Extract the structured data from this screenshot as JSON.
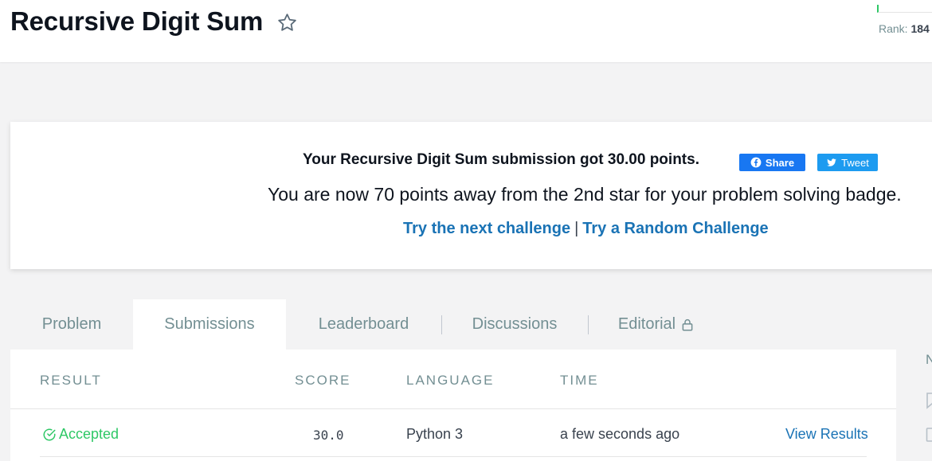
{
  "header": {
    "title": "Recursive Digit Sum",
    "rank_label": "Rank:",
    "rank_value": "184"
  },
  "banner": {
    "message": "Your Recursive Digit Sum submission got 30.00 points.",
    "share_label": "Share",
    "tweet_label": "Tweet",
    "points_message": "You are now 70 points away from the 2nd star for your problem solving badge.",
    "next_challenge": "Try the next challenge",
    "separator": "|",
    "random_challenge": "Try a Random Challenge"
  },
  "tabs": [
    {
      "label": "Problem",
      "active": false
    },
    {
      "label": "Submissions",
      "active": true
    },
    {
      "label": "Leaderboard",
      "active": false
    },
    {
      "label": "Discussions",
      "active": false
    },
    {
      "label": "Editorial",
      "active": false,
      "locked": true
    }
  ],
  "table": {
    "headers": [
      "RESULT",
      "SCORE",
      "LANGUAGE",
      "TIME"
    ],
    "rows": [
      {
        "result": "Accepted",
        "score": "30.0",
        "language": "Python 3",
        "time": "a few seconds ago",
        "action": "View Results"
      }
    ]
  },
  "sidebar": {
    "letter": "N"
  },
  "colors": {
    "accent": "#1a73b5",
    "success": "#2ec866",
    "facebook": "#1877f2",
    "twitter": "#1d9bf0"
  },
  "icons": [
    "star-icon",
    "facebook-icon",
    "twitter-icon",
    "lock-icon",
    "check-circle-icon",
    "bookmark-icon",
    "document-icon"
  ]
}
